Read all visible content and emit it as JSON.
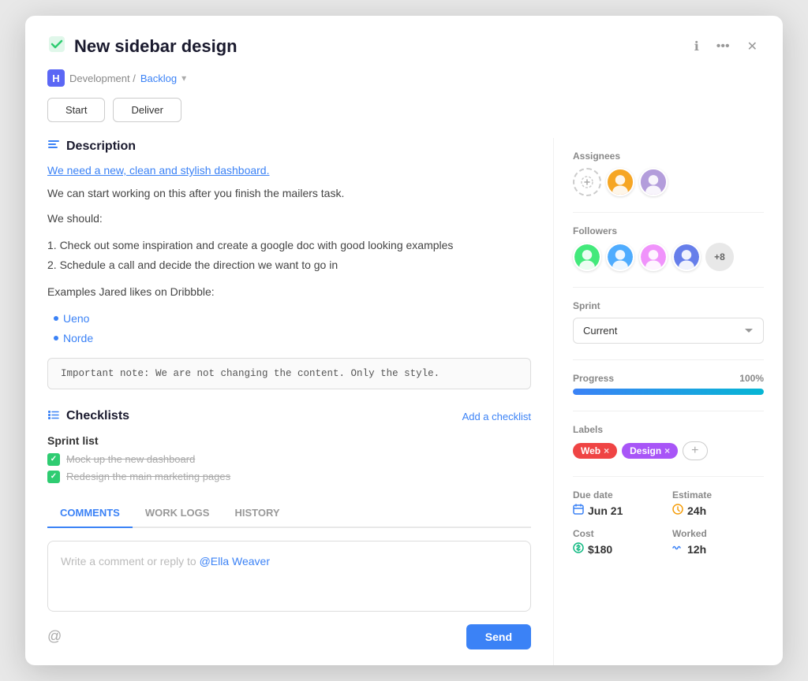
{
  "modal": {
    "title": "New sidebar design",
    "checkmark": "✔",
    "breadcrumb": {
      "badge": "H",
      "prefix": "Development / ",
      "link": "Backlog",
      "arrow": "▾"
    },
    "buttons": {
      "start": "Start",
      "deliver": "Deliver"
    },
    "header_icons": {
      "info": "ℹ",
      "more": "•••",
      "close": "✕"
    }
  },
  "description": {
    "section_title": "Description",
    "link_text": "We need a new, clean and stylish dashboard.",
    "paragraph1": "We can start working on this after you finish the mailers task.",
    "paragraph2": "We should:",
    "list": [
      "1. Check out some inspiration and create a google doc with good looking examples",
      "2. Schedule a call and decide the direction we want to go in"
    ],
    "examples_label": "Examples Jared likes on Dribbble:",
    "bullets": [
      "Ueno",
      "Norde"
    ],
    "note": "Important note: We are not changing the content. Only the style."
  },
  "checklists": {
    "section_title": "Checklists",
    "add_label": "Add a checklist",
    "list_title": "Sprint list",
    "items": [
      "Mock up the new dashboard",
      "Redesign the main marketing pages"
    ]
  },
  "tabs": {
    "items": [
      "COMMENTS",
      "WORK LOGS",
      "HISTORY"
    ],
    "active": "COMMENTS"
  },
  "comment": {
    "placeholder": "Write a comment or reply to ",
    "mention": "@Ella Weaver",
    "send_label": "Send",
    "at_icon": "@"
  },
  "sidebar": {
    "assignees_label": "Assignees",
    "add_icon": "⊕",
    "followers_label": "Followers",
    "followers_more": "+8",
    "sprint_label": "Sprint",
    "sprint_value": "Current",
    "progress_label": "Progress",
    "progress_value": "100",
    "progress_unit": "%",
    "progress_pct": 100,
    "labels_label": "Labels",
    "labels": [
      {
        "text": "Web",
        "color": "web"
      },
      {
        "text": "Design",
        "color": "design"
      }
    ],
    "due_date_label": "Due date",
    "due_date_value": "Jun 21",
    "estimate_label": "Estimate",
    "estimate_value": "24h",
    "cost_label": "Cost",
    "cost_value": "$180",
    "worked_label": "Worked",
    "worked_value": "12h"
  }
}
